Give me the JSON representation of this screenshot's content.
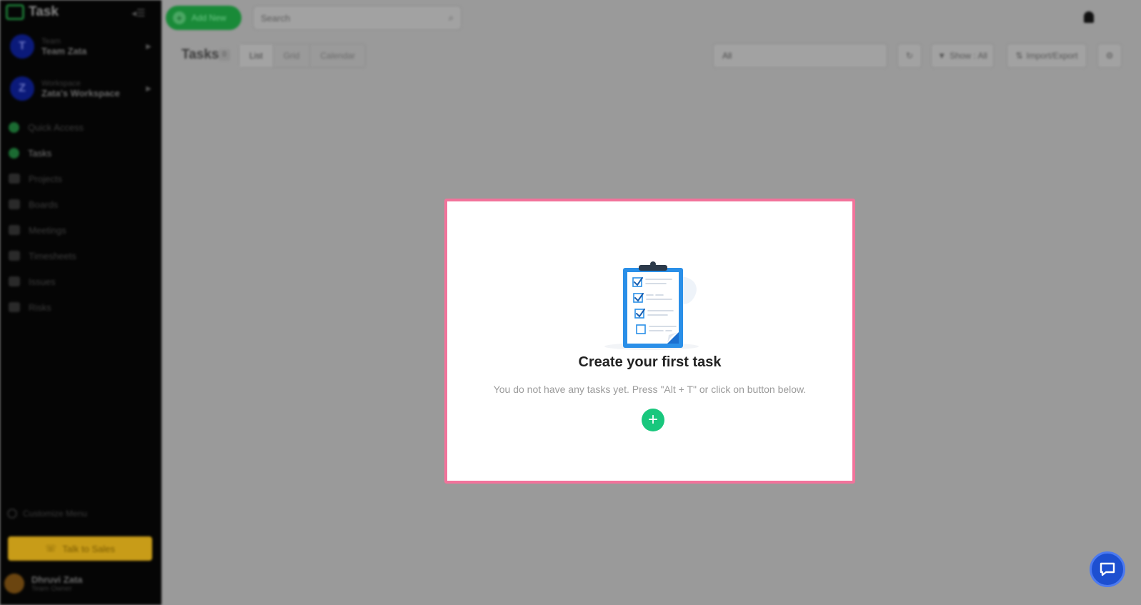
{
  "app": {
    "name": "Task"
  },
  "sidebar": {
    "team": {
      "kicker": "Team",
      "name": "Team Zata",
      "initial": "T"
    },
    "workspace": {
      "kicker": "Workspace",
      "name": "Zata's Workspace",
      "initial": "Z"
    },
    "items": [
      {
        "label": "Quick Access",
        "icon": "grid-icon"
      },
      {
        "label": "Tasks",
        "icon": "tasks-icon",
        "active": true
      },
      {
        "label": "Projects",
        "icon": "folder-icon"
      },
      {
        "label": "Boards",
        "icon": "board-icon"
      },
      {
        "label": "Meetings",
        "icon": "calendar-icon"
      },
      {
        "label": "Timesheets",
        "icon": "timer-icon"
      },
      {
        "label": "Issues",
        "icon": "issue-icon"
      },
      {
        "label": "Risks",
        "icon": "warning-icon"
      }
    ],
    "customize_label": "Customize Menu",
    "sales_label": "Talk to Sales",
    "user": {
      "name": "Dhruvi Zata",
      "role": "Team Owner"
    }
  },
  "topbar": {
    "add_new_label": "Add New",
    "search_placeholder": "Search"
  },
  "toolbar": {
    "title": "Tasks",
    "count": "0",
    "view_tabs": [
      "List",
      "Grid",
      "Calendar"
    ],
    "filter_value": "All",
    "show_label": "Show : All",
    "import_export_label": "Import/Export"
  },
  "empty_state": {
    "title": "Create your first task",
    "subtitle": "You do not have any tasks yet. Press \"Alt + T\" or click on button below."
  },
  "colors": {
    "accent": "#19c77d",
    "highlight_border": "#f2739b",
    "chat": "#1d4fd0"
  }
}
